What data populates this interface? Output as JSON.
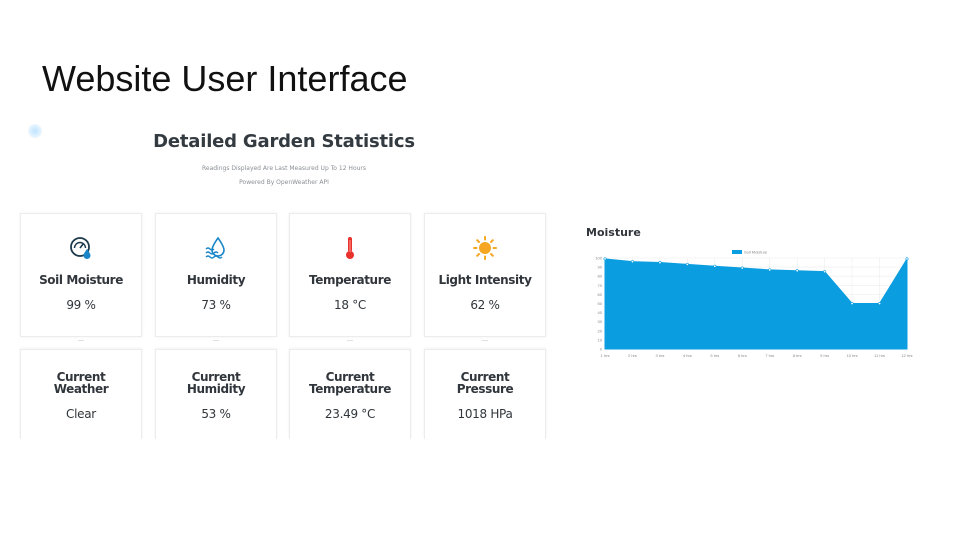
{
  "slide": {
    "title": "Website User Interface"
  },
  "header": {
    "title": "Detailed Garden Statistics",
    "subtitle_line1": "Readings Displayed Are Last Measured Up To 12 Hours",
    "subtitle_line2": "Powered By OpenWeather API"
  },
  "sensor_cards": [
    {
      "label": "Soil Moisture",
      "value": "99 %",
      "icon": "soil-moisture-gauge-icon",
      "color": "#1a86c8"
    },
    {
      "label": "Humidity",
      "value": "73 %",
      "icon": "water-drop-waves-icon",
      "color": "#1a86c8"
    },
    {
      "label": "Temperature",
      "value": "18 °C",
      "icon": "thermometer-icon",
      "color": "#e8322b"
    },
    {
      "label": "Light Intensity",
      "value": "62 %",
      "icon": "sun-icon",
      "color": "#f5a623"
    }
  ],
  "weather_cards": [
    {
      "label_line1": "Current",
      "label_line2": "Weather",
      "value": "Clear"
    },
    {
      "label_line1": "Current",
      "label_line2": "Humidity",
      "value": "53 %"
    },
    {
      "label_line1": "Current",
      "label_line2": "Temperature",
      "value": "23.49 °C"
    },
    {
      "label_line1": "Current",
      "label_line2": "Pressure",
      "value": "1018 HPa"
    }
  ],
  "chart_data": {
    "type": "area",
    "title": "Moisture",
    "legend": "Soil Moisture",
    "legend_position": "top-center",
    "x": [
      "1 hrs",
      "2 hrs",
      "3 hrs",
      "4 hrs",
      "5 hrs",
      "6 hrs",
      "7 hrs",
      "8 hrs",
      "9 hrs",
      "10 hrs",
      "11 hrs",
      "12 hrs"
    ],
    "values": [
      99,
      96,
      95,
      93,
      91,
      89,
      87,
      86,
      85,
      50,
      50,
      99
    ],
    "ylim": [
      0,
      100
    ],
    "yticks": [
      0,
      10,
      20,
      30,
      40,
      50,
      60,
      70,
      80,
      90,
      100
    ],
    "grid": true,
    "color": "#0a9de0"
  }
}
